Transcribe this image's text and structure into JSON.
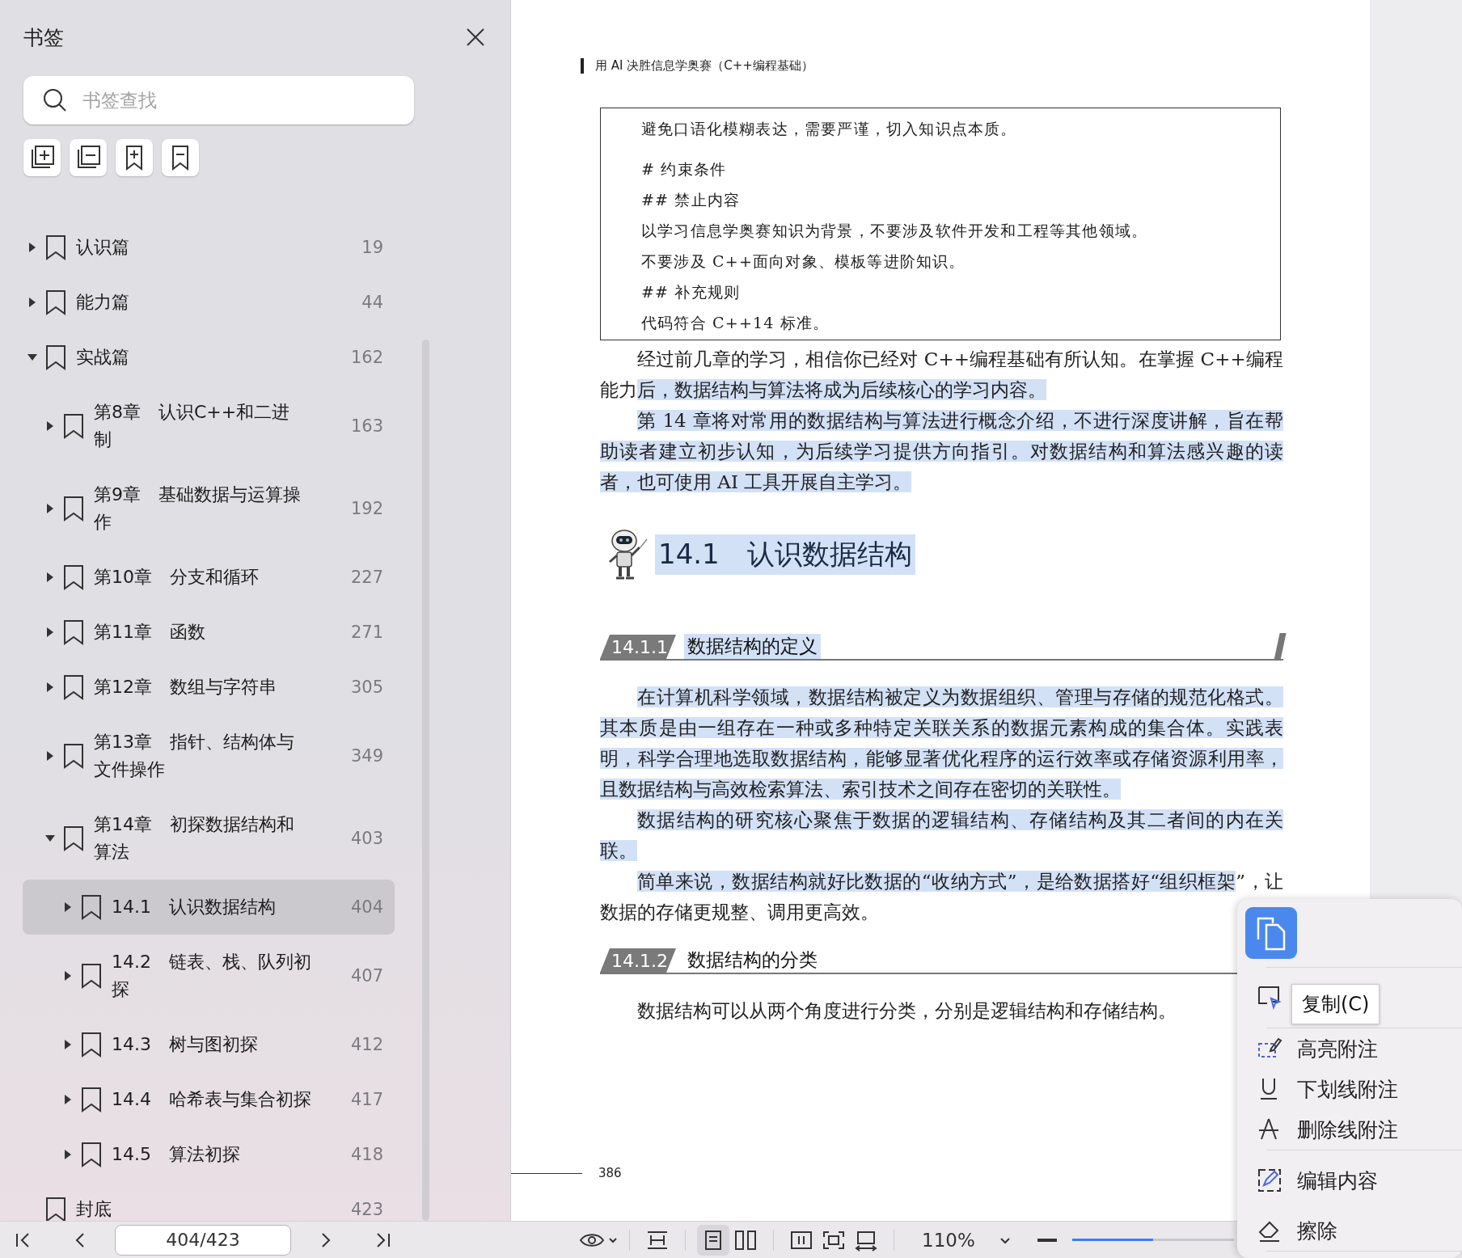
{
  "sidebar": {
    "title": "书签",
    "search": {
      "placeholder": "书签查找"
    },
    "bookmarks": [
      {
        "label": "认识篇",
        "page": "19",
        "kind": "folder",
        "expanded": false,
        "selected": false
      },
      {
        "label": "能力篇",
        "page": "44",
        "kind": "folder",
        "expanded": false,
        "selected": false
      },
      {
        "label": "实战篇",
        "page": "162",
        "kind": "folder",
        "expanded": true,
        "selected": false,
        "children": [
          {
            "label": "第8章　认识C++和二进制",
            "page": "163",
            "kind": "folder",
            "expanded": false,
            "selected": false
          },
          {
            "label": "第9章　基础数据与运算操作",
            "page": "192",
            "kind": "folder",
            "expanded": false,
            "selected": false
          },
          {
            "label": "第10章　分支和循环",
            "page": "227",
            "kind": "folder",
            "expanded": false,
            "selected": false
          },
          {
            "label": "第11章　函数",
            "page": "271",
            "kind": "folder",
            "expanded": false,
            "selected": false
          },
          {
            "label": "第12章　数组与字符串",
            "page": "305",
            "kind": "folder",
            "expanded": false,
            "selected": false
          },
          {
            "label": "第13章　指针、结构体与文件操作",
            "page": "349",
            "kind": "folder",
            "expanded": false,
            "selected": false
          },
          {
            "label": "第14章　初探数据结构和算法",
            "page": "403",
            "kind": "folder",
            "expanded": true,
            "selected": false,
            "children": [
              {
                "label": "14.1　认识数据结构",
                "page": "404",
                "kind": "folder",
                "expanded": false,
                "selected": true
              },
              {
                "label": "14.2　链表、栈、队列初探",
                "page": "407",
                "kind": "folder",
                "expanded": false,
                "selected": false
              },
              {
                "label": "14.3　树与图初探",
                "page": "412",
                "kind": "folder",
                "expanded": false,
                "selected": false
              },
              {
                "label": "14.4　哈希表与集合初探",
                "page": "417",
                "kind": "folder",
                "expanded": false,
                "selected": false
              },
              {
                "label": "14.5　算法初探",
                "page": "418",
                "kind": "folder",
                "expanded": false,
                "selected": false
              }
            ]
          }
        ]
      },
      {
        "label": "封底",
        "page": "423",
        "kind": "leaf",
        "selected": false
      }
    ]
  },
  "page": {
    "running_header": "用 AI 决胜信息学奥赛（C++编程基础）",
    "prompt_box": [
      "避免口语化模糊表达，需要严谨，切入知识点本质。",
      "# 约束条件",
      "## 禁止内容",
      "以学习信息学奥赛知识为背景，不要涉及软件开发和工程等其他领域。",
      "不要涉及 C++面向对象、模板等进阶知识。",
      "## 补充规则",
      "代码符合 C++14 标准。"
    ],
    "blocks": [
      {
        "kind": "paragraph",
        "segments": [
          {
            "text": "经过前几章的学习，相信你已经对 C++编程基础有所认知。在掌握 C++编程能力",
            "highlighted": false
          },
          {
            "text": "后，数据结构与算法将成为后续核心的学习内容。",
            "highlighted": true
          }
        ]
      },
      {
        "kind": "paragraph",
        "segments": [
          {
            "text": "第 14 章将对常用的数据结构与算法进行概念介绍，不进行深度讲解，旨在帮助读者建立初步认知，为后续学习提供方向指引。对数据结构和算法感兴趣的读者，也可使用 AI 工具开展自主学习。",
            "highlighted": true
          }
        ]
      },
      {
        "kind": "heading",
        "number": "14.1",
        "title": "认识数据结构",
        "highlighted": true
      },
      {
        "kind": "section",
        "number": "14.1.1",
        "title": "数据结构的定义",
        "highlighted": true
      },
      {
        "kind": "paragraph",
        "segments": [
          {
            "text": "在计算机科学领域，数据结构被定义为数据组织、管理与存储的规范化格式。其本质是由一组存在一种或多种特定关联关系的数据元素构成的集合体。实践表明，科学合理地选取数据结构，能够显著优化程序的运行效率或存储资源利用率，且数据结构与高效检索算法、索引技术之间存在密切的关联性。",
            "highlighted": true
          }
        ]
      },
      {
        "kind": "paragraph",
        "segments": [
          {
            "text": "数据结构的研究核心聚焦于数据的逻辑结构、存储结构及其二者间的内在关联。",
            "highlighted": true
          }
        ]
      },
      {
        "kind": "paragraph",
        "segments": [
          {
            "text": "简单来说，数据结构就好比数据的“收纳方式”，是给数据搭好“组织框架",
            "highlighted": true
          },
          {
            "text": "”，让数据的存储更规整、调用更高效。",
            "highlighted": false
          }
        ]
      },
      {
        "kind": "section",
        "number": "14.1.2",
        "title": "数据结构的分类",
        "highlighted": false
      },
      {
        "kind": "paragraph",
        "segments": [
          {
            "text": "数据结构可以从两个角度进行分类，分别是逻辑结构和存储结构。",
            "highlighted": false
          }
        ]
      }
    ],
    "page_number": "386"
  },
  "context_menu": {
    "tooltip": "复制(C)",
    "items": [
      {
        "kind": "copy"
      },
      {
        "kind": "separator"
      },
      {
        "kind": "select"
      },
      {
        "kind": "separator"
      },
      {
        "kind": "highlight",
        "label": "高亮附注"
      },
      {
        "kind": "underline",
        "label": "下划线附注"
      },
      {
        "kind": "strikethrough",
        "label": "删除线附注"
      },
      {
        "kind": "separator"
      },
      {
        "kind": "edit",
        "label": "编辑内容"
      },
      {
        "kind": "erase",
        "label": "擦除"
      },
      {
        "kind": "separator"
      }
    ]
  },
  "bottom_bar": {
    "page_field": "404/423",
    "view_buttons": [
      {
        "kind": "eye",
        "selected": false
      },
      {
        "kind": "fit-height",
        "selected": false
      },
      {
        "kind": "single-page",
        "selected": true
      },
      {
        "kind": "two-page",
        "selected": false
      },
      {
        "kind": "columns",
        "selected": false
      },
      {
        "kind": "fit-frame",
        "selected": false
      },
      {
        "kind": "fit-width",
        "selected": false
      }
    ],
    "zoom": "110%",
    "zoom_slider": {
      "level": 0.5
    }
  }
}
